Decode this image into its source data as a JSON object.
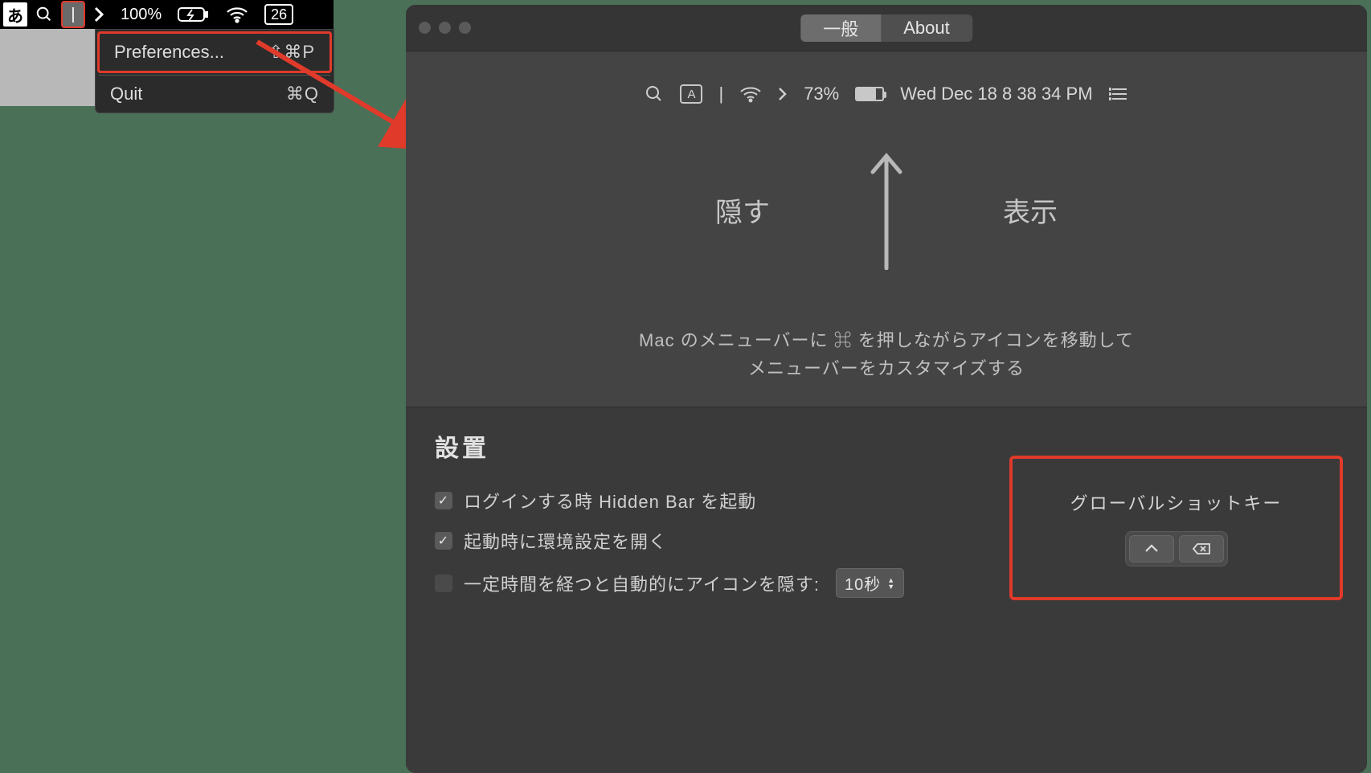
{
  "menubar": {
    "ime": "あ",
    "battery_pct": "100%",
    "date_badge": "26"
  },
  "dropdown": {
    "preferences": {
      "label": "Preferences...",
      "shortcut": "⇧⌘P"
    },
    "quit": {
      "label": "Quit",
      "shortcut": "⌘Q"
    }
  },
  "prefs": {
    "tabs": {
      "general": "一般",
      "about": "About"
    },
    "preview": {
      "ime_box": "A",
      "battery_pct": "73%",
      "datetime": "Wed Dec 18  8 38 34 PM"
    },
    "hide_label": "隠す",
    "show_label": "表示",
    "help_line1": "Mac のメニューバーに  ⌘ を押しながらアイコンを移動して",
    "help_line2": "メニューバーをカスタマイズする",
    "settings_header": "設置",
    "checks": {
      "login": "ログインする時 Hidden Bar を起動",
      "open_prefs": "起動時に環境設定を開く",
      "auto_hide": "一定時間を経つと自動的にアイコンを隠す:"
    },
    "auto_hide_select": "10秒",
    "shortcut_title": "グローバルショットキー"
  }
}
